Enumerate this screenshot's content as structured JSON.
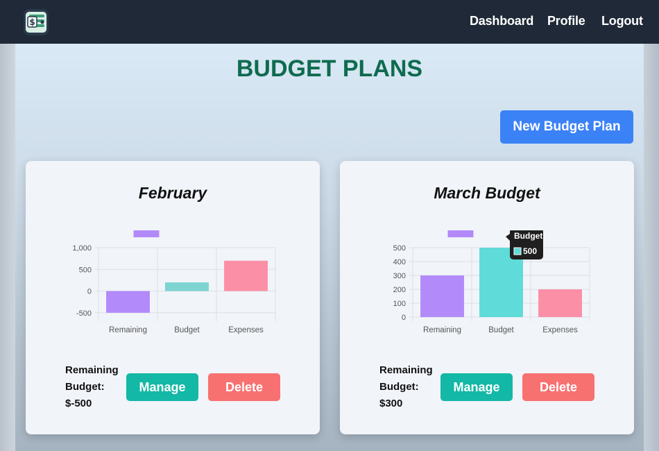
{
  "nav": {
    "links": [
      "Dashboard",
      "Profile",
      "Logout"
    ],
    "background": "#1f2937"
  },
  "page": {
    "title": "BUDGET PLANS",
    "title_color": "#0f6b4f",
    "new_button": "New Budget Plan",
    "accent": "#3b82f6"
  },
  "cards": [
    {
      "title": "February",
      "remaining_label": [
        "Remaining",
        "Budget:"
      ],
      "remaining_value": "$-500",
      "manage": "Manage",
      "delete": "Delete"
    },
    {
      "title": "March Budget",
      "remaining_label": [
        "Remaining",
        "Budget:"
      ],
      "remaining_value": "$300",
      "manage": "Manage",
      "delete": "Delete"
    }
  ],
  "chart_data": [
    {
      "type": "bar",
      "categories": [
        "Remaining",
        "Budget",
        "Expenses"
      ],
      "values": [
        -500,
        200,
        700
      ],
      "colors": [
        "#b28afa",
        "#7dd4d1",
        "#fb8fa6"
      ],
      "ylim": [
        -600,
        1000
      ],
      "yticks": [
        -500,
        0,
        500,
        1000
      ],
      "ytick_labels": [
        "-500",
        "0",
        "500",
        "1,000"
      ],
      "legend": {
        "placement": "top",
        "label": ""
      },
      "grid": true
    },
    {
      "type": "bar",
      "categories": [
        "Remaining",
        "Budget",
        "Expenses"
      ],
      "values": [
        300,
        500,
        200
      ],
      "colors": [
        "#b28afa",
        "#5fdbd9",
        "#fb8fa6"
      ],
      "ylim": [
        0,
        500
      ],
      "yticks": [
        0,
        100,
        200,
        300,
        400,
        500
      ],
      "ytick_labels": [
        "0",
        "100",
        "200",
        "300",
        "400",
        "500"
      ],
      "legend": {
        "placement": "top",
        "label": ""
      },
      "grid": true,
      "tooltip": {
        "title": "Budget",
        "value": "500"
      }
    }
  ]
}
